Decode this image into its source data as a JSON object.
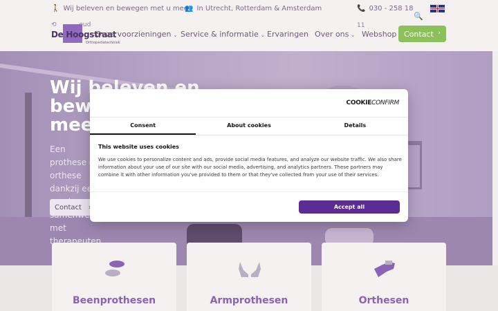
{
  "topbar": {
    "tagline": "Wij beleven en bewegen met u mee!",
    "locations": "In Utrecht, Rotterdam & Amsterdam",
    "phone": "030 - 258 18"
  },
  "nav": {
    "logo_name": "De Hoogstraat",
    "logo_sub": "Orthopedietechniek",
    "history_label": "oud",
    "counter": "11",
    "items": [
      {
        "label": "Onze voorzieningen"
      },
      {
        "label": "Service & informatie"
      },
      {
        "label": "Ervaringen"
      },
      {
        "label": "Over ons"
      },
      {
        "label": "Webshop"
      }
    ],
    "contact_label": "Contact"
  },
  "hero": {
    "title": "Wij beleven en bewegen met u mee",
    "text": "Een prothese of orthese dankzij een goede samenwerking met therapeuten",
    "button_label": "Contact"
  },
  "cards": [
    {
      "title": "Beenprothesen",
      "icon": "footprints-icon"
    },
    {
      "title": "Armprothesen",
      "icon": "hands-icon"
    },
    {
      "title": "Orthesen",
      "icon": "brace-icon"
    }
  ],
  "cookie": {
    "brand_a": "C",
    "brand_b": "OOKIE",
    "brand_c": "CONFIRM",
    "tabs": [
      {
        "label": "Consent"
      },
      {
        "label": "About cookies"
      },
      {
        "label": "Details"
      }
    ],
    "heading": "This website uses cookies",
    "body": "We use cookies to personalize content and ads, provide social media features, and analyze our website traffic. We also share information about your use of our site with our social media, advertising, and analytics partners. These partners may combine it with other information you've provided to them or that they've collected from your use of their services.",
    "accept_label": "Accept all"
  },
  "colors": {
    "brand_purple": "#8a62b6",
    "accept_purple": "#5b2d92",
    "contact_green": "#8cc05a"
  }
}
